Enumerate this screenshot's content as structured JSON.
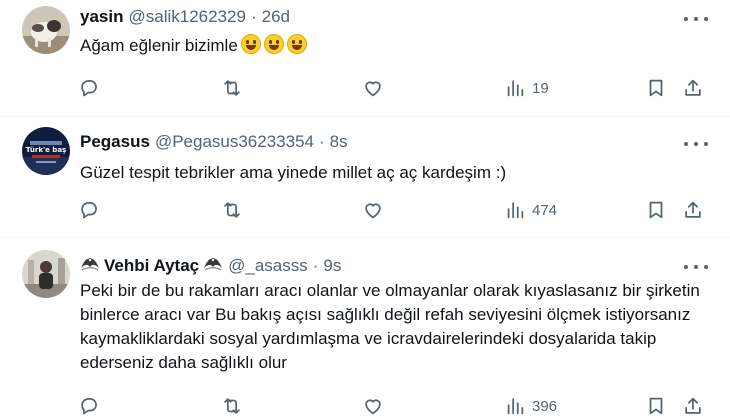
{
  "tweets": [
    {
      "name": "yasin",
      "handle": "@salik1262329",
      "sep": "·",
      "time": "26d",
      "text": "Ağam eğlenir bizimle",
      "emoji": [
        "grinning-face-emoji",
        "grinning-face-emoji",
        "grinning-face-emoji"
      ],
      "views": "19"
    },
    {
      "name": "Pegasus",
      "handle": "@Pegasus36233354",
      "sep": "·",
      "time": "8s",
      "text": "Güzel tespit tebrikler ama yinede millet aç aç kardeşim :)",
      "views": "474"
    },
    {
      "name": "Vehbi Aytaç",
      "handle": "@_asasss",
      "sep": "·",
      "time": "9s",
      "text": "Peki bir de bu rakamları aracı olanlar ve olmayanlar olarak kıyaslasanız bir şirketin binlerce aracı var Bu bakış açısı sağlıklı değil refah seviyesini ölçmek istiyorsanız kaymakliklardaki sosyal yardımlaşma ve icravdairelerindeki dosyalarida takip ederseniz daha sağlıklı olur",
      "views": "396"
    }
  ],
  "avatar_texts": {
    "pegasus": "Türk'e baş"
  },
  "colors": {
    "text": "#0f1419",
    "secondary": "#536471",
    "divider": "#eff3f4"
  },
  "icons": [
    "reply-icon",
    "retweet-icon",
    "like-icon",
    "views-icon",
    "bookmark-icon",
    "share-icon",
    "more-icon",
    "eagle-badge-icon"
  ]
}
